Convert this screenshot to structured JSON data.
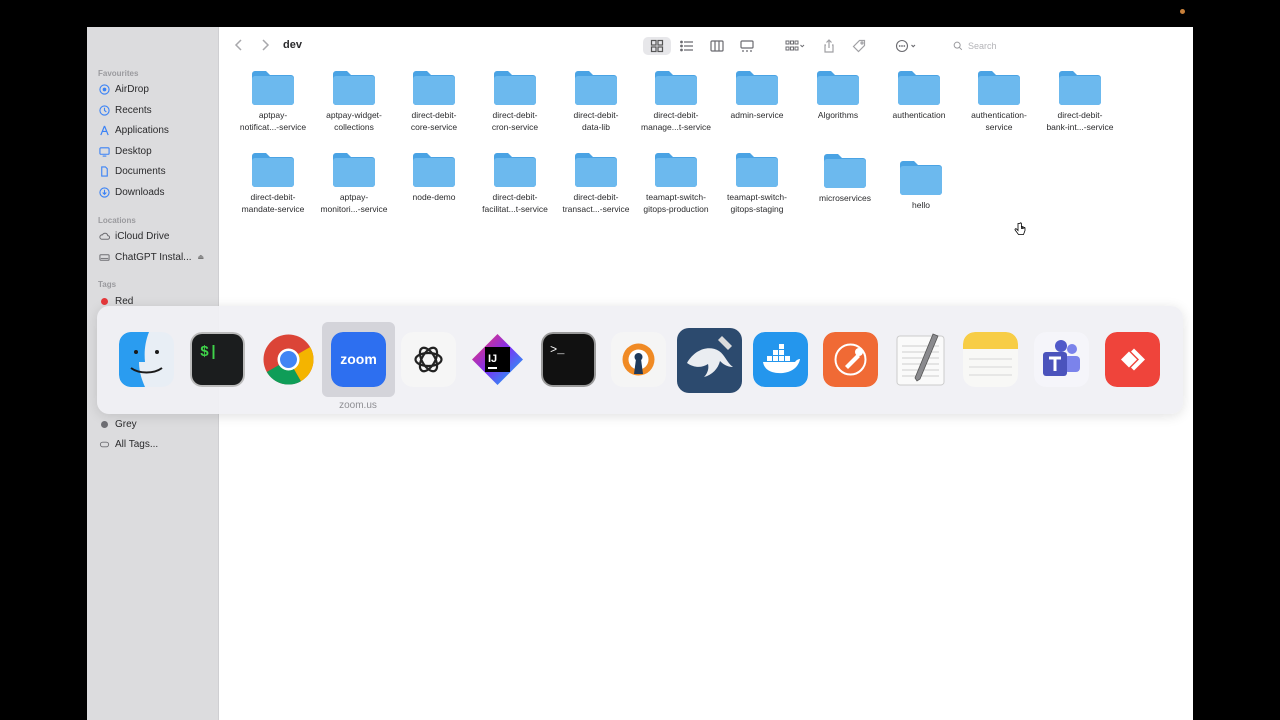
{
  "window": {
    "title": "dev"
  },
  "sidebar": {
    "favourites_title": "Favourites",
    "favourites": [
      {
        "label": "AirDrop",
        "icon": "airdrop-icon"
      },
      {
        "label": "Recents",
        "icon": "clock-icon"
      },
      {
        "label": "Applications",
        "icon": "applications-icon"
      },
      {
        "label": "Desktop",
        "icon": "desktop-icon"
      },
      {
        "label": "Documents",
        "icon": "document-icon"
      },
      {
        "label": "Downloads",
        "icon": "download-icon"
      }
    ],
    "locations_title": "Locations",
    "locations": [
      {
        "label": "iCloud Drive",
        "icon": "cloud-icon"
      },
      {
        "label": "ChatGPT Instal...",
        "icon": "disk-icon",
        "eject": "⏏"
      }
    ],
    "tags_title": "Tags",
    "tags": [
      {
        "label": "Red",
        "color": "#e5383b"
      },
      {
        "label": "Grey",
        "color": "#6e6e73"
      }
    ],
    "all_tags_label": "All Tags..."
  },
  "toolbar": {
    "search_placeholder": "Search"
  },
  "folders": [
    {
      "line1": "aptpay-",
      "line2": "notificat...-service"
    },
    {
      "line1": "aptpay-widget-",
      "line2": "collections"
    },
    {
      "line1": "direct-debit-",
      "line2": "core-service"
    },
    {
      "line1": "direct-debit-",
      "line2": "cron-service"
    },
    {
      "line1": "direct-debit-",
      "line2": "data-lib"
    },
    {
      "line1": "direct-debit-",
      "line2": "manage...t-service"
    },
    {
      "line1": "admin-service",
      "line2": ""
    },
    {
      "line1": "Algorithms",
      "line2": ""
    },
    {
      "line1": "authentication",
      "line2": ""
    },
    {
      "line1": "authentication-",
      "line2": "service"
    },
    {
      "line1": "direct-debit-",
      "line2": "bank-int...-service"
    },
    {
      "line1": "direct-debit-",
      "line2": "mandate-service"
    },
    {
      "line1": "aptpay-",
      "line2": "monitori...-service"
    },
    {
      "line1": "node-demo",
      "line2": ""
    },
    {
      "line1": "direct-debit-",
      "line2": "facilitat...t-service"
    },
    {
      "line1": "direct-debit-",
      "line2": "transact...-service"
    },
    {
      "line1": "teamapt-switch-",
      "line2": "gitops-production"
    },
    {
      "line1": "teamapt-switch-",
      "line2": "gitops-staging"
    },
    {
      "line1": "microservices",
      "line2": ""
    },
    {
      "line1": "hello",
      "line2": ""
    }
  ],
  "dock": {
    "hover_label": "zoom.us",
    "zoom_text": "zoom",
    "intellij_text": "IJ",
    "terminal_prompt": ">_",
    "iterm_prompt": "$|",
    "apps": [
      "finder-icon",
      "iterm-icon",
      "chrome-icon",
      "zoom-icon",
      "chatgpt-icon",
      "intellij-icon",
      "terminal-icon",
      "openvpn-icon",
      "mysql-workbench-icon",
      "docker-icon",
      "postman-icon",
      "textedit-icon",
      "notes-icon",
      "teams-icon",
      "anydesk-icon"
    ]
  }
}
